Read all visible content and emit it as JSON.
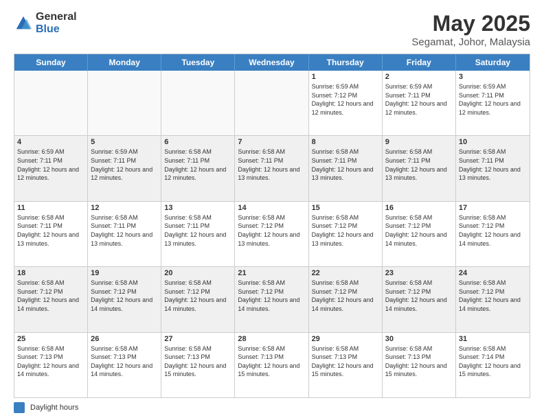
{
  "logo": {
    "general": "General",
    "blue": "Blue",
    "icon_color": "#2a6db5"
  },
  "title": "May 2025",
  "subtitle": "Segamat, Johor, Malaysia",
  "header": {
    "days": [
      "Sunday",
      "Monday",
      "Tuesday",
      "Wednesday",
      "Thursday",
      "Friday",
      "Saturday"
    ]
  },
  "legend": {
    "label": "Daylight hours"
  },
  "rows": [
    {
      "cells": [
        {
          "day": "",
          "info": "",
          "empty": true
        },
        {
          "day": "",
          "info": "",
          "empty": true
        },
        {
          "day": "",
          "info": "",
          "empty": true
        },
        {
          "day": "",
          "info": "",
          "empty": true
        },
        {
          "day": "1",
          "info": "Sunrise: 6:59 AM\nSunset: 7:12 PM\nDaylight: 12 hours\nand 12 minutes."
        },
        {
          "day": "2",
          "info": "Sunrise: 6:59 AM\nSunset: 7:11 PM\nDaylight: 12 hours\nand 12 minutes."
        },
        {
          "day": "3",
          "info": "Sunrise: 6:59 AM\nSunset: 7:11 PM\nDaylight: 12 hours\nand 12 minutes."
        }
      ]
    },
    {
      "cells": [
        {
          "day": "4",
          "info": "Sunrise: 6:59 AM\nSunset: 7:11 PM\nDaylight: 12 hours\nand 12 minutes.",
          "shaded": true
        },
        {
          "day": "5",
          "info": "Sunrise: 6:59 AM\nSunset: 7:11 PM\nDaylight: 12 hours\nand 12 minutes.",
          "shaded": true
        },
        {
          "day": "6",
          "info": "Sunrise: 6:58 AM\nSunset: 7:11 PM\nDaylight: 12 hours\nand 12 minutes.",
          "shaded": true
        },
        {
          "day": "7",
          "info": "Sunrise: 6:58 AM\nSunset: 7:11 PM\nDaylight: 12 hours\nand 13 minutes.",
          "shaded": true
        },
        {
          "day": "8",
          "info": "Sunrise: 6:58 AM\nSunset: 7:11 PM\nDaylight: 12 hours\nand 13 minutes.",
          "shaded": true
        },
        {
          "day": "9",
          "info": "Sunrise: 6:58 AM\nSunset: 7:11 PM\nDaylight: 12 hours\nand 13 minutes.",
          "shaded": true
        },
        {
          "day": "10",
          "info": "Sunrise: 6:58 AM\nSunset: 7:11 PM\nDaylight: 12 hours\nand 13 minutes.",
          "shaded": true
        }
      ]
    },
    {
      "cells": [
        {
          "day": "11",
          "info": "Sunrise: 6:58 AM\nSunset: 7:11 PM\nDaylight: 12 hours\nand 13 minutes."
        },
        {
          "day": "12",
          "info": "Sunrise: 6:58 AM\nSunset: 7:11 PM\nDaylight: 12 hours\nand 13 minutes."
        },
        {
          "day": "13",
          "info": "Sunrise: 6:58 AM\nSunset: 7:11 PM\nDaylight: 12 hours\nand 13 minutes."
        },
        {
          "day": "14",
          "info": "Sunrise: 6:58 AM\nSunset: 7:12 PM\nDaylight: 12 hours\nand 13 minutes."
        },
        {
          "day": "15",
          "info": "Sunrise: 6:58 AM\nSunset: 7:12 PM\nDaylight: 12 hours\nand 13 minutes."
        },
        {
          "day": "16",
          "info": "Sunrise: 6:58 AM\nSunset: 7:12 PM\nDaylight: 12 hours\nand 14 minutes."
        },
        {
          "day": "17",
          "info": "Sunrise: 6:58 AM\nSunset: 7:12 PM\nDaylight: 12 hours\nand 14 minutes."
        }
      ]
    },
    {
      "cells": [
        {
          "day": "18",
          "info": "Sunrise: 6:58 AM\nSunset: 7:12 PM\nDaylight: 12 hours\nand 14 minutes.",
          "shaded": true
        },
        {
          "day": "19",
          "info": "Sunrise: 6:58 AM\nSunset: 7:12 PM\nDaylight: 12 hours\nand 14 minutes.",
          "shaded": true
        },
        {
          "day": "20",
          "info": "Sunrise: 6:58 AM\nSunset: 7:12 PM\nDaylight: 12 hours\nand 14 minutes.",
          "shaded": true
        },
        {
          "day": "21",
          "info": "Sunrise: 6:58 AM\nSunset: 7:12 PM\nDaylight: 12 hours\nand 14 minutes.",
          "shaded": true
        },
        {
          "day": "22",
          "info": "Sunrise: 6:58 AM\nSunset: 7:12 PM\nDaylight: 12 hours\nand 14 minutes.",
          "shaded": true
        },
        {
          "day": "23",
          "info": "Sunrise: 6:58 AM\nSunset: 7:12 PM\nDaylight: 12 hours\nand 14 minutes.",
          "shaded": true
        },
        {
          "day": "24",
          "info": "Sunrise: 6:58 AM\nSunset: 7:12 PM\nDaylight: 12 hours\nand 14 minutes.",
          "shaded": true
        }
      ]
    },
    {
      "cells": [
        {
          "day": "25",
          "info": "Sunrise: 6:58 AM\nSunset: 7:13 PM\nDaylight: 12 hours\nand 14 minutes."
        },
        {
          "day": "26",
          "info": "Sunrise: 6:58 AM\nSunset: 7:13 PM\nDaylight: 12 hours\nand 14 minutes."
        },
        {
          "day": "27",
          "info": "Sunrise: 6:58 AM\nSunset: 7:13 PM\nDaylight: 12 hours\nand 15 minutes."
        },
        {
          "day": "28",
          "info": "Sunrise: 6:58 AM\nSunset: 7:13 PM\nDaylight: 12 hours\nand 15 minutes."
        },
        {
          "day": "29",
          "info": "Sunrise: 6:58 AM\nSunset: 7:13 PM\nDaylight: 12 hours\nand 15 minutes."
        },
        {
          "day": "30",
          "info": "Sunrise: 6:58 AM\nSunset: 7:13 PM\nDaylight: 12 hours\nand 15 minutes."
        },
        {
          "day": "31",
          "info": "Sunrise: 6:58 AM\nSunset: 7:14 PM\nDaylight: 12 hours\nand 15 minutes."
        }
      ]
    }
  ]
}
